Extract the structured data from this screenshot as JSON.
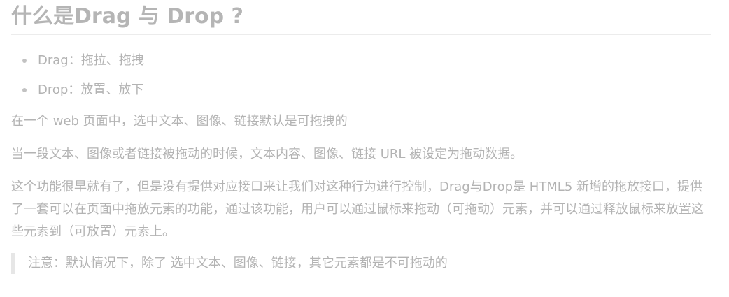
{
  "heading": "什么是Drag 与 Drop ?",
  "list": [
    "Drag：拖拉、拖拽",
    "Drop：放置、放下"
  ],
  "paragraphs": [
    "在一个 web 页面中，选中文本、图像、链接默认是可拖拽的",
    "当一段文本、图像或者链接被拖动的时候，文本内容、图像、链接 URL 被设定为拖动数据。",
    "这个功能很早就有了，但是没有提供对应接口来让我们对这种行为进行控制，Drag与Drop是 HTML5 新增的拖放接口，提供了一套可以在页面中拖放元素的功能，通过该功能，用户可以通过鼠标来拖动（可拖动）元素，并可以通过释放鼠标来放置这些元素到（可放置）元素上。"
  ],
  "note": "注意：默认情况下，除了 选中文本、图像、链接，其它元素都是不可拖动的"
}
